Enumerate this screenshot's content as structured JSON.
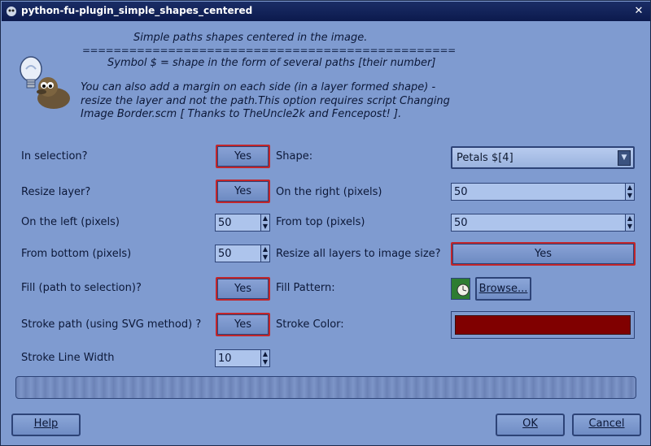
{
  "window": {
    "title": "python-fu-plugin_simple_shapes_centered"
  },
  "header": {
    "line1": "Simple paths shapes centered in the image.",
    "separator": "================================================",
    "line2": "Symbol $ = shape in the form of several paths [their number]",
    "line3": "You can also add a margin on each side (in a layer formed shape) -",
    "line4": "resize the layer and not the path.This option requires script Changing",
    "line5": "Image Border.scm [ Thanks to TheUncle2k and Fencepost! ]."
  },
  "left": {
    "in_selection_label": "In selection?",
    "in_selection_value": "Yes",
    "resize_layer_label": "Resize layer?",
    "resize_layer_value": "Yes",
    "on_left_label": "On the left (pixels)",
    "on_left_value": "50",
    "from_bottom_label": "From bottom (pixels)",
    "from_bottom_value": "50",
    "fill_label": "Fill (path to selection)?",
    "fill_value": "Yes",
    "stroke_path_label": "Stroke path (using SVG method) ?",
    "stroke_path_value": "Yes",
    "stroke_width_label": "Stroke Line Width",
    "stroke_width_value": "10"
  },
  "right": {
    "shape_label": "Shape:",
    "shape_value": "Petals $[4]",
    "on_right_label": "On the right (pixels)",
    "on_right_value": "50",
    "from_top_label": "From top (pixels)",
    "from_top_value": "50",
    "resize_all_label": "Resize all layers to image size?",
    "resize_all_value": "Yes",
    "fill_pattern_label": "Fill Pattern:",
    "browse_label": "Browse...",
    "stroke_color_label": "Stroke Color:",
    "stroke_color": "#800000"
  },
  "buttons": {
    "help": "Help",
    "ok": "OK",
    "cancel": "Cancel"
  },
  "progress": 0
}
